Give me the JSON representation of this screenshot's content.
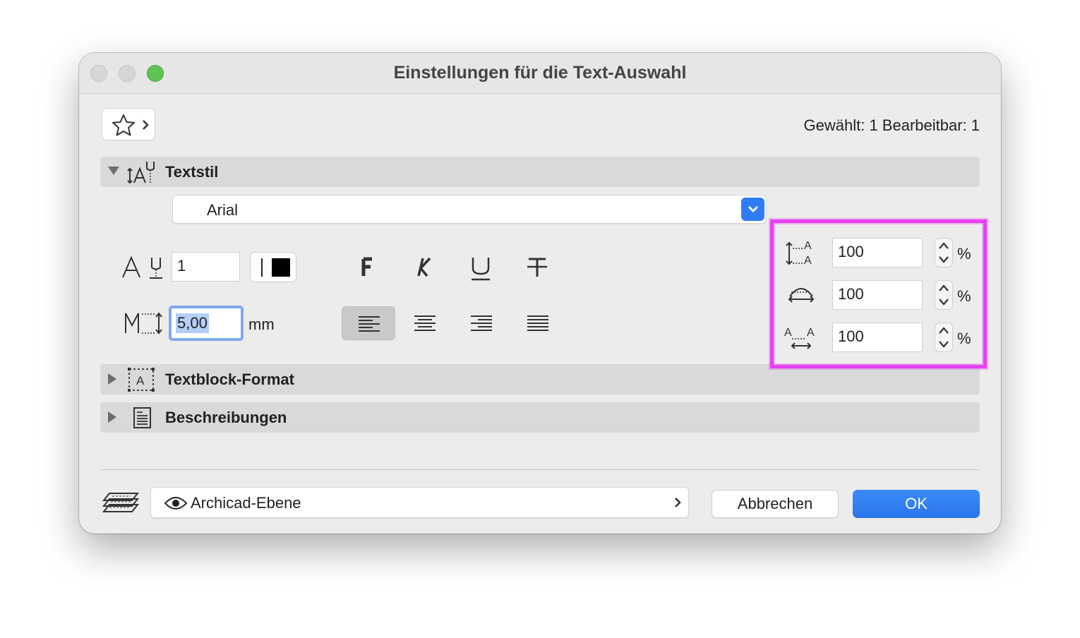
{
  "window": {
    "title": "Einstellungen für die Text-Auswahl"
  },
  "selection_info": "Gewählt: 1 Bearbeitbar: 1",
  "sections": {
    "textstil": {
      "label": "Textstil",
      "expanded": true
    },
    "textblock": {
      "label": "Textblock-Format",
      "expanded": false
    },
    "beschreibungen": {
      "label": "Beschreibungen",
      "expanded": false
    }
  },
  "textstil": {
    "font": "Arial",
    "pen": "1",
    "color": "#000000",
    "size": "5,00",
    "size_unit": "mm",
    "styles": [
      "F",
      "K",
      "U",
      "T"
    ],
    "alignment": "left",
    "line_spacing": {
      "value": "100",
      "unit": "%"
    },
    "width_factor": {
      "value": "100",
      "unit": "%"
    },
    "char_spacing": {
      "value": "100",
      "unit": "%"
    }
  },
  "footer": {
    "layer": "Archicad-Ebene",
    "cancel_label": "Abbrechen",
    "ok_label": "OK"
  },
  "colors": {
    "accent": "#2f7cf6",
    "highlight": "#e641f0"
  }
}
